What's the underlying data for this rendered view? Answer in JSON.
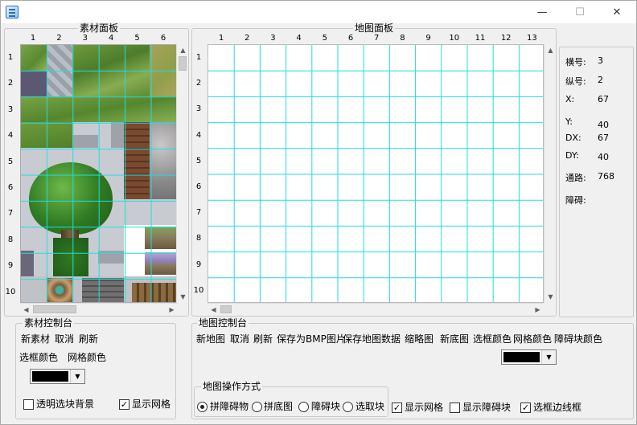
{
  "window": {
    "minimize_glyph": "—",
    "maximize_glyph": "☐",
    "close_glyph": "✕"
  },
  "material_panel": {
    "title": "素材面板",
    "col_labels": [
      "1",
      "2",
      "3",
      "4",
      "5",
      "6"
    ],
    "row_labels": [
      "1",
      "2",
      "3",
      "4",
      "5",
      "6",
      "7",
      "8",
      "9",
      "10"
    ]
  },
  "map_panel": {
    "title": "地图面板",
    "col_labels": [
      "1",
      "2",
      "3",
      "4",
      "5",
      "6",
      "7",
      "8",
      "9",
      "10",
      "11",
      "12",
      "13"
    ],
    "row_labels": [
      "1",
      "2",
      "3",
      "4",
      "5",
      "6",
      "7",
      "8",
      "9",
      "10"
    ]
  },
  "info": {
    "hnum_label": "横号:",
    "hnum_value": "3",
    "vnum_label": "纵号:",
    "vnum_value": "2",
    "x_label": "X:",
    "x_value": "67",
    "y_label": "Y:",
    "y_value": "40",
    "dx_label": "DX:",
    "dx_value": "67",
    "dy_label": "DY:",
    "dy_value": "40",
    "road_label": "通路:",
    "road_value": "768",
    "obstacle_label": "障碍:"
  },
  "material_console": {
    "title": "素材控制台",
    "new_material": "新素材",
    "cancel": "取消",
    "refresh": "刷新",
    "sel_color": "选框颜色",
    "grid_color": "网格颜色",
    "transparent_bg": "透明选块背景",
    "transparent_checked": false,
    "show_grid": "显示网格",
    "show_grid_checked": true
  },
  "map_console": {
    "title": "地图控制台",
    "new_map": "新地图",
    "cancel": "取消",
    "refresh": "刷新",
    "save_bmp": "保存为BMP图片",
    "save_data": "保存地图数据",
    "thumbnail": "缩略图",
    "new_base": "新底图",
    "sel_color": "选框颜色",
    "grid_color": "网格颜色",
    "obstacle_color": "障碍块颜色",
    "op_title": "地图操作方式",
    "modes": [
      "拼障碍物",
      "拼底图",
      "障碍块",
      "选取块"
    ],
    "mode_selected": 0,
    "show_grid": "显示网格",
    "show_grid_checked": true,
    "show_obstacle": "显示障碍块",
    "show_obstacle_checked": false,
    "sel_border": "选框边线框",
    "sel_border_checked": true
  },
  "colors": {
    "grid": "#22dddd",
    "swatch": "#000000"
  },
  "check_glyph": "✓"
}
